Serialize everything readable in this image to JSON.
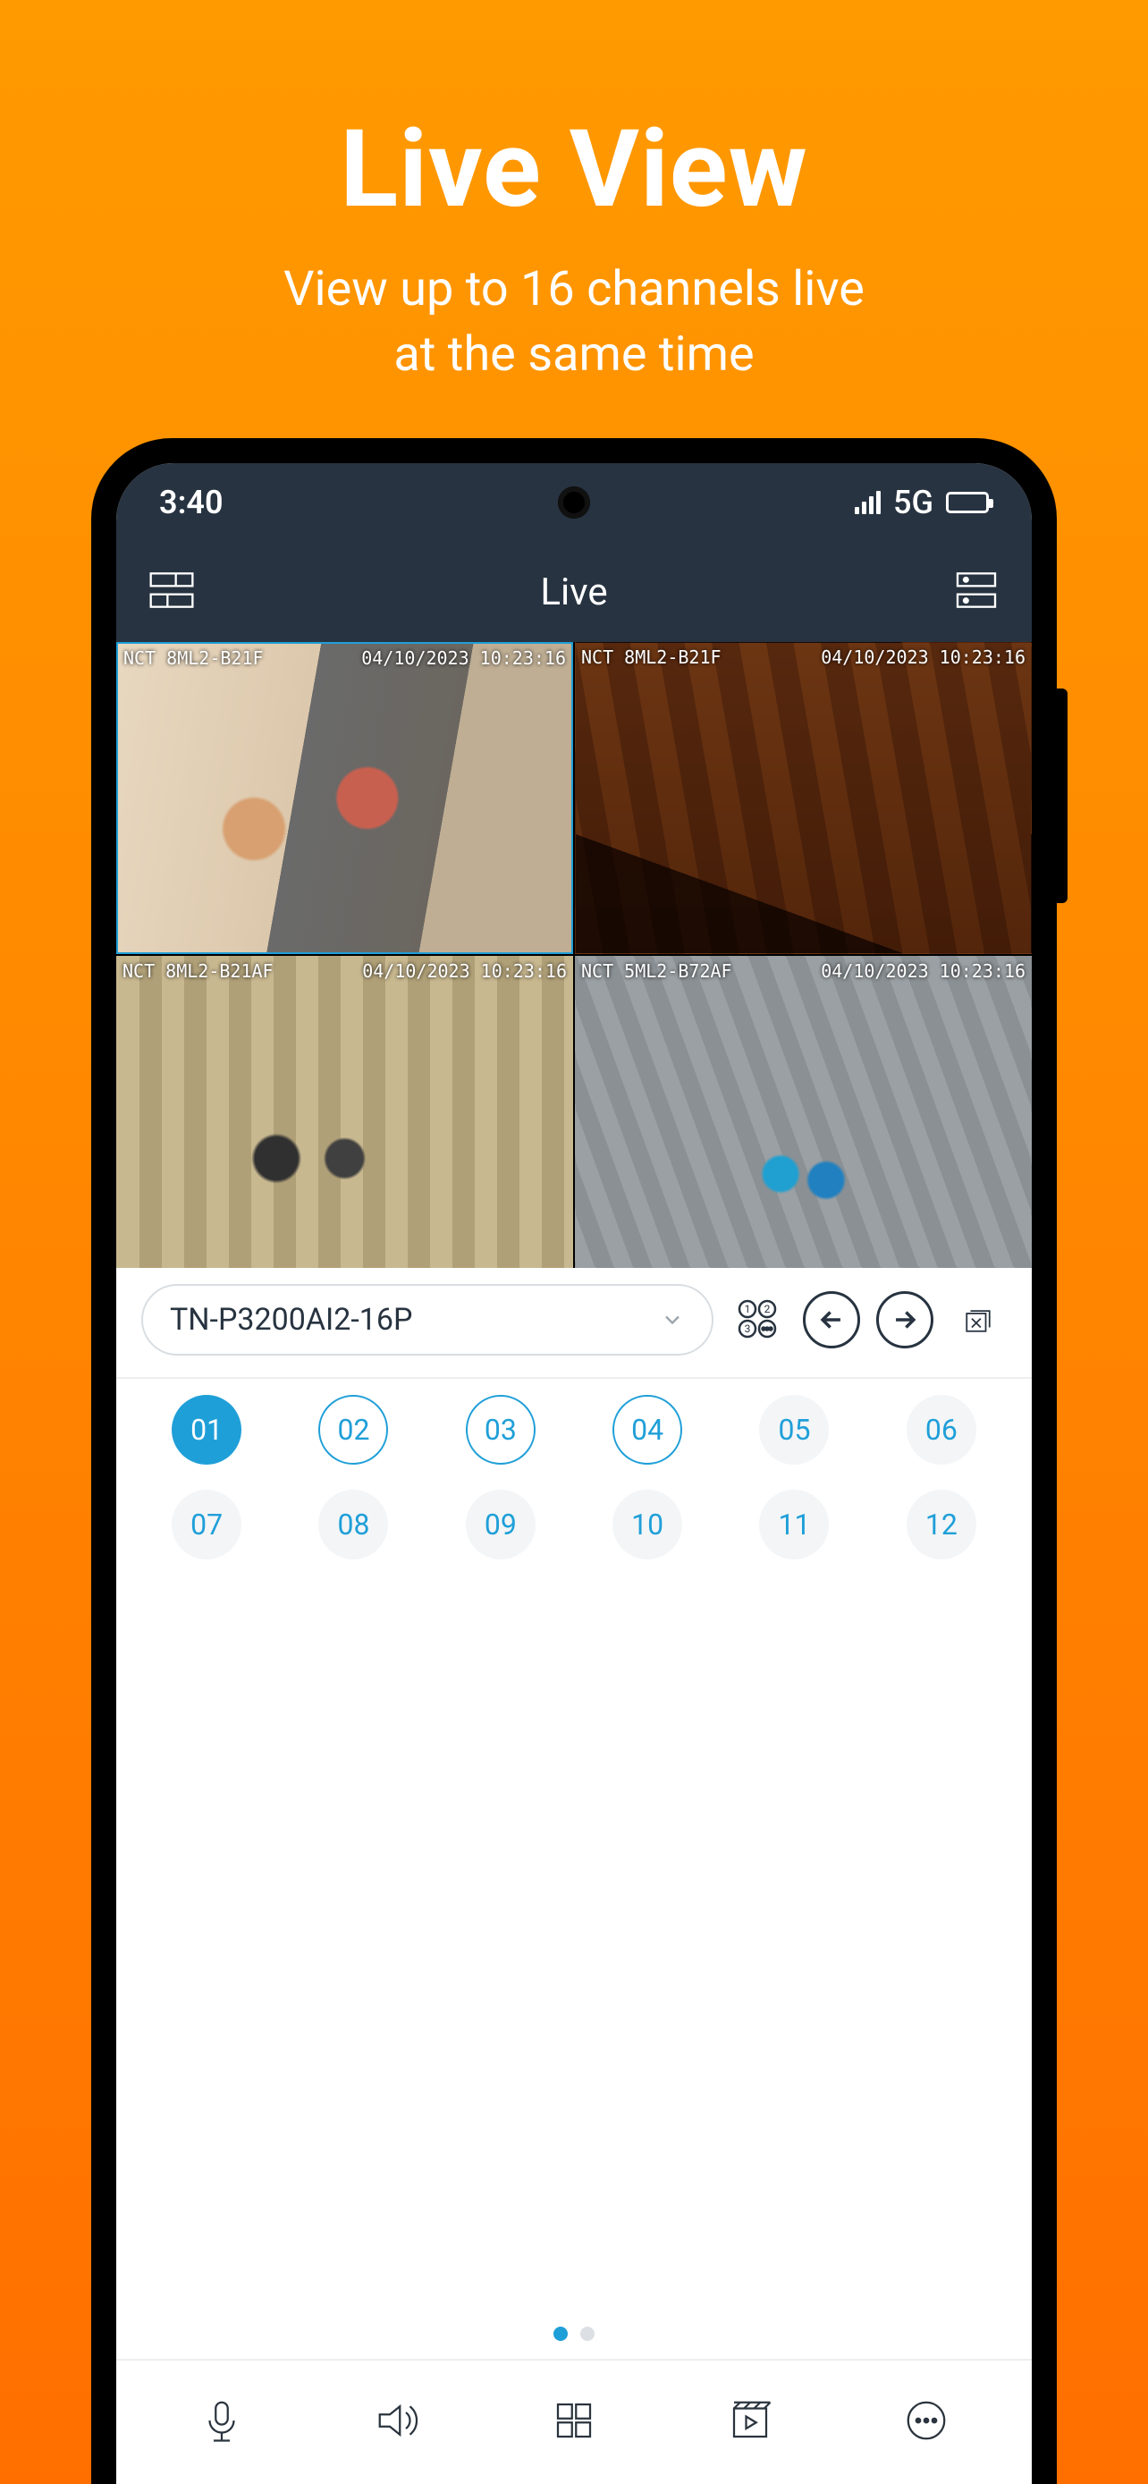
{
  "promo": {
    "title": "Live View",
    "subtitle_line1": "View up to 16 channels live",
    "subtitle_line2": "at the same time"
  },
  "statusbar": {
    "time": "3:40",
    "network_label": "5G"
  },
  "header": {
    "title": "Live",
    "left_icon": "layout-icon",
    "right_icon": "server-list-icon"
  },
  "cameras": [
    {
      "name": "NCT 8ML2-B21F",
      "timestamp": "04/10/2023  10:23:16",
      "selected": true
    },
    {
      "name": "NCT 8ML2-B21F",
      "timestamp": "04/10/2023  10:23:16",
      "selected": false
    },
    {
      "name": "NCT 8ML2-B21AF",
      "timestamp": "04/10/2023  10:23:16",
      "selected": false
    },
    {
      "name": "NCT 5ML2-B72AF",
      "timestamp": "04/10/2023  10:23:16",
      "selected": false
    }
  ],
  "device": {
    "selected": "TN-P3200AI2-16P"
  },
  "channels": [
    {
      "label": "01",
      "style": "active"
    },
    {
      "label": "02",
      "style": "outlined"
    },
    {
      "label": "03",
      "style": "outlined"
    },
    {
      "label": "04",
      "style": "outlined"
    },
    {
      "label": "05",
      "style": "grey"
    },
    {
      "label": "06",
      "style": "grey"
    },
    {
      "label": "07",
      "style": "grey"
    },
    {
      "label": "08",
      "style": "grey"
    },
    {
      "label": "09",
      "style": "grey"
    },
    {
      "label": "10",
      "style": "grey"
    },
    {
      "label": "11",
      "style": "grey"
    },
    {
      "label": "12",
      "style": "grey"
    }
  ],
  "pager": {
    "count": 2,
    "active_index": 0
  },
  "bottombar": {
    "items": [
      "mic-icon",
      "speaker-icon",
      "grid-icon",
      "playback-icon",
      "more-icon"
    ]
  }
}
